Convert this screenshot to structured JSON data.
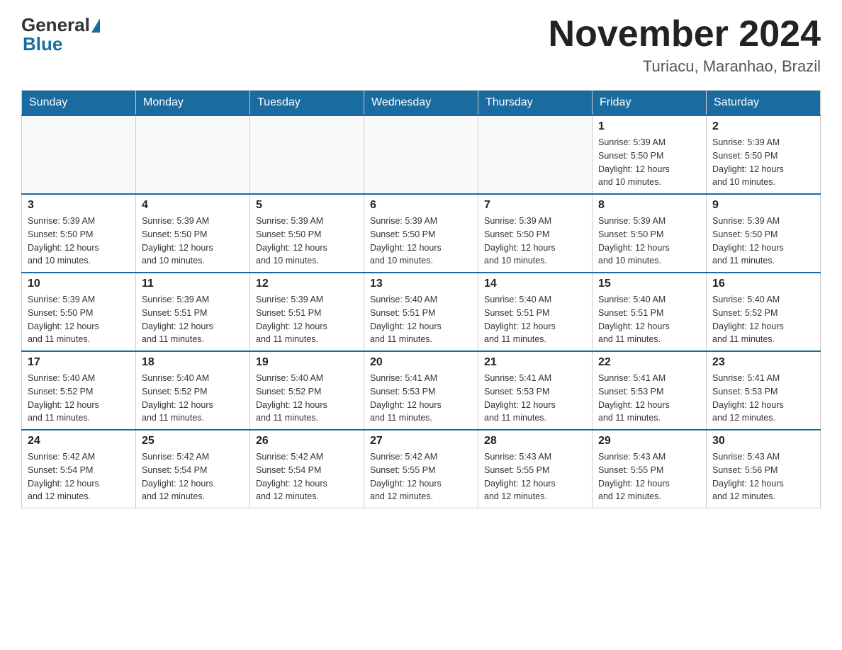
{
  "header": {
    "logo_general": "General",
    "logo_blue": "Blue",
    "month_year": "November 2024",
    "location": "Turiacu, Maranhao, Brazil"
  },
  "days_of_week": [
    "Sunday",
    "Monday",
    "Tuesday",
    "Wednesday",
    "Thursday",
    "Friday",
    "Saturday"
  ],
  "weeks": [
    [
      {
        "day": "",
        "info": ""
      },
      {
        "day": "",
        "info": ""
      },
      {
        "day": "",
        "info": ""
      },
      {
        "day": "",
        "info": ""
      },
      {
        "day": "",
        "info": ""
      },
      {
        "day": "1",
        "info": "Sunrise: 5:39 AM\nSunset: 5:50 PM\nDaylight: 12 hours\nand 10 minutes."
      },
      {
        "day": "2",
        "info": "Sunrise: 5:39 AM\nSunset: 5:50 PM\nDaylight: 12 hours\nand 10 minutes."
      }
    ],
    [
      {
        "day": "3",
        "info": "Sunrise: 5:39 AM\nSunset: 5:50 PM\nDaylight: 12 hours\nand 10 minutes."
      },
      {
        "day": "4",
        "info": "Sunrise: 5:39 AM\nSunset: 5:50 PM\nDaylight: 12 hours\nand 10 minutes."
      },
      {
        "day": "5",
        "info": "Sunrise: 5:39 AM\nSunset: 5:50 PM\nDaylight: 12 hours\nand 10 minutes."
      },
      {
        "day": "6",
        "info": "Sunrise: 5:39 AM\nSunset: 5:50 PM\nDaylight: 12 hours\nand 10 minutes."
      },
      {
        "day": "7",
        "info": "Sunrise: 5:39 AM\nSunset: 5:50 PM\nDaylight: 12 hours\nand 10 minutes."
      },
      {
        "day": "8",
        "info": "Sunrise: 5:39 AM\nSunset: 5:50 PM\nDaylight: 12 hours\nand 10 minutes."
      },
      {
        "day": "9",
        "info": "Sunrise: 5:39 AM\nSunset: 5:50 PM\nDaylight: 12 hours\nand 11 minutes."
      }
    ],
    [
      {
        "day": "10",
        "info": "Sunrise: 5:39 AM\nSunset: 5:50 PM\nDaylight: 12 hours\nand 11 minutes."
      },
      {
        "day": "11",
        "info": "Sunrise: 5:39 AM\nSunset: 5:51 PM\nDaylight: 12 hours\nand 11 minutes."
      },
      {
        "day": "12",
        "info": "Sunrise: 5:39 AM\nSunset: 5:51 PM\nDaylight: 12 hours\nand 11 minutes."
      },
      {
        "day": "13",
        "info": "Sunrise: 5:40 AM\nSunset: 5:51 PM\nDaylight: 12 hours\nand 11 minutes."
      },
      {
        "day": "14",
        "info": "Sunrise: 5:40 AM\nSunset: 5:51 PM\nDaylight: 12 hours\nand 11 minutes."
      },
      {
        "day": "15",
        "info": "Sunrise: 5:40 AM\nSunset: 5:51 PM\nDaylight: 12 hours\nand 11 minutes."
      },
      {
        "day": "16",
        "info": "Sunrise: 5:40 AM\nSunset: 5:52 PM\nDaylight: 12 hours\nand 11 minutes."
      }
    ],
    [
      {
        "day": "17",
        "info": "Sunrise: 5:40 AM\nSunset: 5:52 PM\nDaylight: 12 hours\nand 11 minutes."
      },
      {
        "day": "18",
        "info": "Sunrise: 5:40 AM\nSunset: 5:52 PM\nDaylight: 12 hours\nand 11 minutes."
      },
      {
        "day": "19",
        "info": "Sunrise: 5:40 AM\nSunset: 5:52 PM\nDaylight: 12 hours\nand 11 minutes."
      },
      {
        "day": "20",
        "info": "Sunrise: 5:41 AM\nSunset: 5:53 PM\nDaylight: 12 hours\nand 11 minutes."
      },
      {
        "day": "21",
        "info": "Sunrise: 5:41 AM\nSunset: 5:53 PM\nDaylight: 12 hours\nand 11 minutes."
      },
      {
        "day": "22",
        "info": "Sunrise: 5:41 AM\nSunset: 5:53 PM\nDaylight: 12 hours\nand 11 minutes."
      },
      {
        "day": "23",
        "info": "Sunrise: 5:41 AM\nSunset: 5:53 PM\nDaylight: 12 hours\nand 12 minutes."
      }
    ],
    [
      {
        "day": "24",
        "info": "Sunrise: 5:42 AM\nSunset: 5:54 PM\nDaylight: 12 hours\nand 12 minutes."
      },
      {
        "day": "25",
        "info": "Sunrise: 5:42 AM\nSunset: 5:54 PM\nDaylight: 12 hours\nand 12 minutes."
      },
      {
        "day": "26",
        "info": "Sunrise: 5:42 AM\nSunset: 5:54 PM\nDaylight: 12 hours\nand 12 minutes."
      },
      {
        "day": "27",
        "info": "Sunrise: 5:42 AM\nSunset: 5:55 PM\nDaylight: 12 hours\nand 12 minutes."
      },
      {
        "day": "28",
        "info": "Sunrise: 5:43 AM\nSunset: 5:55 PM\nDaylight: 12 hours\nand 12 minutes."
      },
      {
        "day": "29",
        "info": "Sunrise: 5:43 AM\nSunset: 5:55 PM\nDaylight: 12 hours\nand 12 minutes."
      },
      {
        "day": "30",
        "info": "Sunrise: 5:43 AM\nSunset: 5:56 PM\nDaylight: 12 hours\nand 12 minutes."
      }
    ]
  ]
}
